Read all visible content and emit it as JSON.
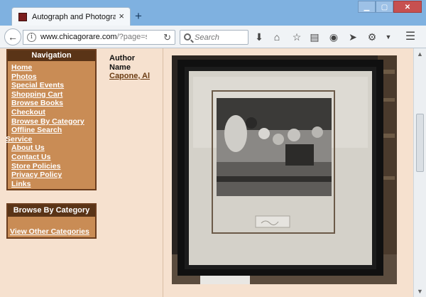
{
  "browser": {
    "tab_title": "Autograph and Photograph",
    "tab_close": "×",
    "new_tab": "+",
    "window_controls": [
      "▁",
      "▢",
      "✕"
    ],
    "url_domain": "www.chicagorare.com",
    "url_path": "/?page=sho",
    "search_placeholder": "Search"
  },
  "icons": {
    "back": "back-arrow-icon",
    "download": "download-icon",
    "home": "home-icon",
    "bookmark": "star-icon",
    "reading_list": "clipboard-icon",
    "pocket": "pocket-icon",
    "send": "send-icon",
    "extension": "extension-icon",
    "menu": "hamburger-menu-icon"
  },
  "sidebar": {
    "nav_title": "Navigation",
    "nav_items": [
      "Home",
      "Photos",
      "Special Events",
      "Shopping Cart",
      "Browse Books",
      "Checkout",
      "Browse By Category",
      "Offline Search",
      "Service",
      "About Us",
      "Contact Us",
      "Store Policies",
      "Privacy Policy",
      "Links"
    ],
    "category_title": "Browse By Category",
    "category_link": "View Other Categories"
  },
  "author": {
    "label_1": "Author",
    "label_2": "Name",
    "name": "Capone, Al"
  },
  "colors": {
    "page_bg": "#f6e1cf",
    "box_bg": "#c98c55",
    "box_header": "#5a3417",
    "link_brown": "#6a3b12"
  }
}
